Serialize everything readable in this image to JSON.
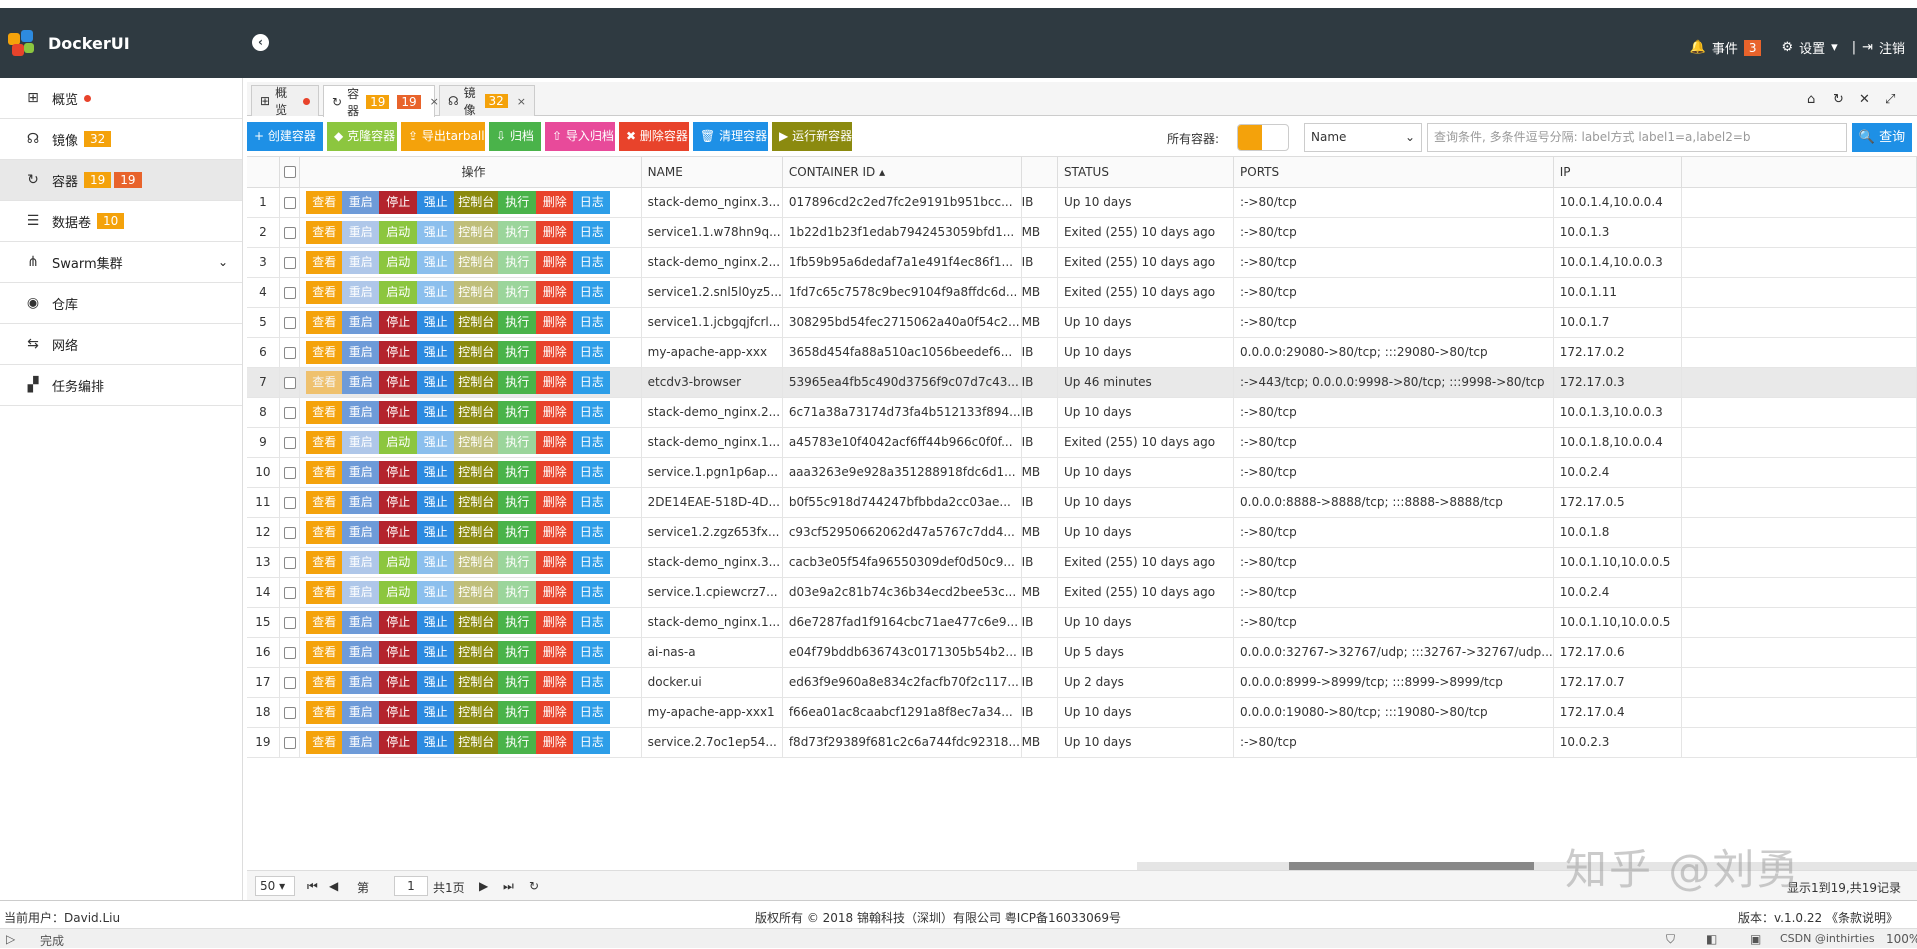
{
  "header": {
    "brand": "DockerUI",
    "events_label": "事件",
    "events_count": "3",
    "settings_label": "设置",
    "logout_label": "注销"
  },
  "sidebar": {
    "items": [
      {
        "label": "概览",
        "icon": "windows-icon",
        "dot": true
      },
      {
        "label": "镜像",
        "icon": "headset-icon",
        "badge": "32"
      },
      {
        "label": "容器",
        "icon": "refresh-icon",
        "badge": "19",
        "badge2": "19",
        "active": true
      },
      {
        "label": "数据卷",
        "icon": "database-icon",
        "badge": "10"
      },
      {
        "label": "Swarm集群",
        "icon": "sitemap-icon",
        "chevron": true
      },
      {
        "label": "仓库",
        "icon": "broadcast-icon"
      },
      {
        "label": "网络",
        "icon": "network-icon"
      },
      {
        "label": "任务编排",
        "icon": "puzzle-icon"
      }
    ]
  },
  "tabs": [
    {
      "label": "概览"
    },
    {
      "label": "容器",
      "b1": "19",
      "b2": "19"
    },
    {
      "label": "镜像",
      "b1": "32"
    }
  ],
  "toolbar": {
    "buttons": [
      "创建容器",
      "克隆容器",
      "导出tarball",
      "归档",
      "导入归档",
      "删除容器",
      "清理容器",
      "运行新容器"
    ],
    "all_label": "所有容器:",
    "select": "Name",
    "search_placeholder": "查询条件, 多条件逗号分隔: label方式 label1=a,label2=b",
    "query": "查询"
  },
  "columns": {
    "ops": "操作",
    "name": "NAME",
    "id": "CONTAINER ID ▴",
    "status": "STATUS",
    "ports": "PORTS",
    "ip": "IP"
  },
  "actions": [
    "查看",
    "重启",
    "停止",
    "强止",
    "控制台",
    "执行",
    "删除",
    "日志"
  ],
  "start_label": "启动",
  "rows": [
    {
      "n": "1",
      "name": "stack-demo_nginx.3...",
      "id": "017896cd2c2ed7fc2e9191b951bcc...",
      "size": "IB",
      "status": "Up 10 days",
      "ports": ":->80/tcp",
      "ip": "10.0.1.4,10.0.0.4",
      "up": true
    },
    {
      "n": "2",
      "name": "service1.1.w78hn9q...",
      "id": "1b22d1b23f1edab7942453059bfd1...",
      "size": "MB",
      "status": "Exited (255) 10 days ago",
      "ports": ":->80/tcp",
      "ip": "10.0.1.3",
      "up": false
    },
    {
      "n": "3",
      "name": "stack-demo_nginx.2...",
      "id": "1fb59b95a6dedaf7a1e491f4ec86f1...",
      "size": "IB",
      "status": "Exited (255) 10 days ago",
      "ports": ":->80/tcp",
      "ip": "10.0.1.4,10.0.0.3",
      "up": false
    },
    {
      "n": "4",
      "name": "service1.2.snl5l0yz5...",
      "id": "1fd7c65c7578c9bec9104f9a8ffdc6d...",
      "size": "MB",
      "status": "Exited (255) 10 days ago",
      "ports": ":->80/tcp",
      "ip": "10.0.1.11",
      "up": false
    },
    {
      "n": "5",
      "name": "service1.1.jcbgqjfcrl...",
      "id": "308295bd54fec2715062a40a0f54c2...",
      "size": "MB",
      "status": "Up 10 days",
      "ports": ":->80/tcp",
      "ip": "10.0.1.7",
      "up": true
    },
    {
      "n": "6",
      "name": "my-apache-app-xxx",
      "id": "3658d454fa88a510ac1056beedef6...",
      "size": "IB",
      "status": "Up 10 days",
      "ports": "0.0.0.0:29080->80/tcp; :::29080->80/tcp",
      "ip": "172.17.0.2",
      "up": true
    },
    {
      "n": "7",
      "name": "etcdv3-browser",
      "id": "53965ea4fb5c490d3756f9c07d7c43...",
      "size": "IB",
      "status": "Up 46 minutes",
      "ports": ":->443/tcp; 0.0.0.0:9998->80/tcp; :::9998->80/tcp",
      "ip": "172.17.0.3",
      "up": true,
      "hl": true
    },
    {
      "n": "8",
      "name": "stack-demo_nginx.2...",
      "id": "6c71a38a73174d73fa4b512133f894...",
      "size": "IB",
      "status": "Up 10 days",
      "ports": ":->80/tcp",
      "ip": "10.0.1.3,10.0.0.3",
      "up": true
    },
    {
      "n": "9",
      "name": "stack-demo_nginx.1...",
      "id": "a45783e10f4042acf6ff44b966c0f0f...",
      "size": "IB",
      "status": "Exited (255) 10 days ago",
      "ports": ":->80/tcp",
      "ip": "10.0.1.8,10.0.0.4",
      "up": false
    },
    {
      "n": "10",
      "name": "service.1.pgn1p6ap...",
      "id": "aaa3263e9e928a351288918fdc6d1...",
      "size": "MB",
      "status": "Up 10 days",
      "ports": ":->80/tcp",
      "ip": "10.0.2.4",
      "up": true
    },
    {
      "n": "11",
      "name": "2DE14EAE-518D-4D...",
      "id": "b0f55c918d744247bfbbda2cc03ae...",
      "size": "IB",
      "status": "Up 10 days",
      "ports": "0.0.0.0:8888->8888/tcp; :::8888->8888/tcp",
      "ip": "172.17.0.5",
      "up": true
    },
    {
      "n": "12",
      "name": "service1.2.zgz653fx...",
      "id": "c93cf52950662062d47a5767c7dd4...",
      "size": "MB",
      "status": "Up 10 days",
      "ports": ":->80/tcp",
      "ip": "10.0.1.8",
      "up": true
    },
    {
      "n": "13",
      "name": "stack-demo_nginx.3...",
      "id": "cacb3e05f54fa96550309def0d50c9...",
      "size": "IB",
      "status": "Exited (255) 10 days ago",
      "ports": ":->80/tcp",
      "ip": "10.0.1.10,10.0.0.5",
      "up": false
    },
    {
      "n": "14",
      "name": "service.1.cpiewcrz7...",
      "id": "d03e9a2c81b74c36b34ecd2bee53c...",
      "size": "MB",
      "status": "Exited (255) 10 days ago",
      "ports": ":->80/tcp",
      "ip": "10.0.2.4",
      "up": false
    },
    {
      "n": "15",
      "name": "stack-demo_nginx.1...",
      "id": "d6e7287fad1f9164cbc71ae477c6e9...",
      "size": "IB",
      "status": "Up 10 days",
      "ports": ":->80/tcp",
      "ip": "10.0.1.10,10.0.0.5",
      "up": true
    },
    {
      "n": "16",
      "name": "ai-nas-a",
      "id": "e04f79bddb636743c0171305b54b2...",
      "size": "IB",
      "status": "Up 5 days",
      "ports": "0.0.0.0:32767->32767/udp; :::32767->32767/udp...",
      "ip": "172.17.0.6",
      "up": true
    },
    {
      "n": "17",
      "name": "docker.ui",
      "id": "ed63f9e960a8e834c2facfb70f2c117...",
      "size": "IB",
      "status": "Up 2 days",
      "ports": "0.0.0.0:8999->8999/tcp; :::8999->8999/tcp",
      "ip": "172.17.0.7",
      "up": true
    },
    {
      "n": "18",
      "name": "my-apache-app-xxx1",
      "id": "f66ea01ac8caabcf1291a8f8ec7a34...",
      "size": "IB",
      "status": "Up 10 days",
      "ports": "0.0.0.0:19080->80/tcp; :::19080->80/tcp",
      "ip": "172.17.0.4",
      "up": true
    },
    {
      "n": "19",
      "name": "service.2.7oc1ep54...",
      "id": "f8d73f29389f681c2c6a744fdc92318...",
      "size": "MB",
      "status": "Up 10 days",
      "ports": ":->80/tcp",
      "ip": "10.0.2.3",
      "up": true
    }
  ],
  "pager": {
    "size": "50",
    "page_prefix": "第",
    "page": "1",
    "page_suffix": "共1页",
    "summary": "显示1到19,共19记录"
  },
  "footer": {
    "user": "当前用户：David.Liu",
    "copyright": "版权所有 © 2018 锦翰科技（深圳）有限公司 粤ICP备16033069号",
    "version": "版本：v.1.0.22 《条款说明》"
  },
  "status": {
    "text": "完成",
    "zoom": "100%"
  },
  "watermark": {
    "text": "知乎 @刘勇",
    "csdn": "CSDN @inthirties"
  },
  "colors": {
    "view": "#f4a20b",
    "restart": "#6e9bd8",
    "stop": "#b4242d",
    "kill": "#2d8be0",
    "console": "#8b8a0f",
    "exec": "#4ab34a",
    "delete": "#e8432b",
    "log": "#2d9ee8",
    "start": "#8cc63f",
    "header": "#2f3a41",
    "query": "#1e90e6"
  }
}
